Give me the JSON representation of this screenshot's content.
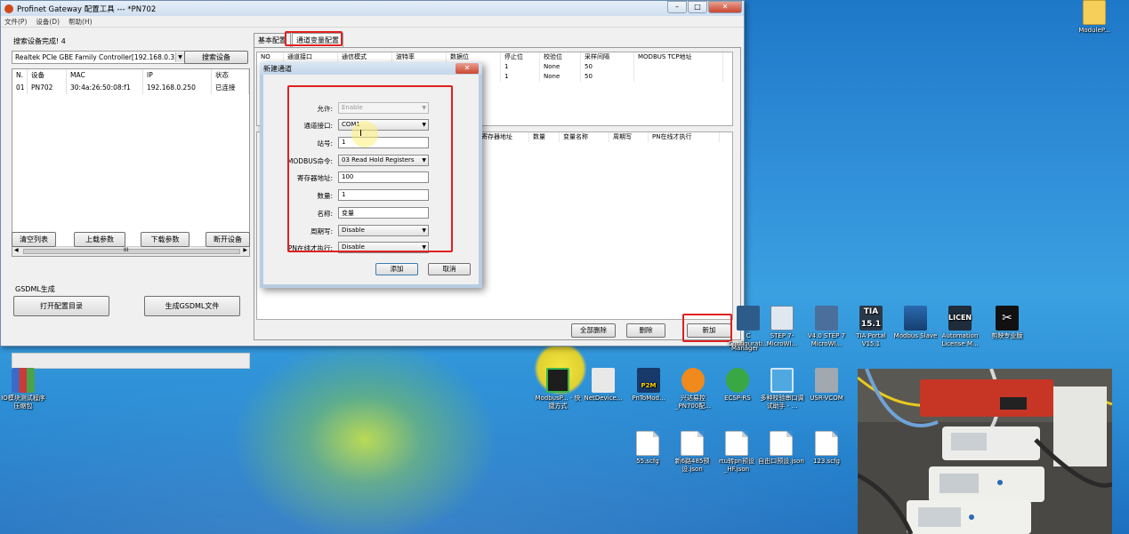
{
  "window": {
    "title": "Profinet Gateway 配置工具 --- *PN702",
    "menu": [
      "文件(P)",
      "设备(D)",
      "帮助(H)"
    ],
    "controls": {
      "minimize": "–",
      "maximize": "□",
      "close": "✕"
    }
  },
  "left": {
    "status": "搜索设备完成! 4",
    "adapter": "Realtek PCIe GBE Family Controller[192.168.0.33",
    "search_button": "搜索设备",
    "device_columns": [
      "N.",
      "设备",
      "MAC",
      "IP",
      "状态"
    ],
    "devices": [
      {
        "n": "01",
        "device": "PN702",
        "mac": "30:4a:26:50:08:f1",
        "ip": "192.168.0.250",
        "status": "已连接"
      }
    ],
    "scroll_grip": "III",
    "buttons": {
      "clear": "清空列表",
      "upload": "上载参数",
      "download": "下载参数",
      "disconnect": "断开设备"
    },
    "gsdml_label": "GSDML生成",
    "open_dir": "打开配置目录",
    "gen_gsdml": "生成GSDML文件"
  },
  "tabs": [
    "基本配置",
    "通道变量配置"
  ],
  "channel_grid": {
    "columns": [
      "NO",
      "通道接口",
      "通信模式",
      "波特率",
      "数据位",
      "停止位",
      "校验位",
      "采样间隔",
      "MODBUS TCP地址"
    ],
    "rows": [
      [
        "",
        "",
        "",
        "",
        "",
        "1",
        "None",
        "50",
        ""
      ],
      [
        "",
        "",
        "",
        "",
        "",
        "1",
        "None",
        "50",
        ""
      ]
    ]
  },
  "var_grid": {
    "columns": [
      "寄存器地址",
      "数量",
      "变量名称",
      "周期写",
      "PN在线才执行"
    ]
  },
  "bottom_buttons": {
    "delete_all": "全部删除",
    "delete": "删除",
    "add": "新加"
  },
  "dialog": {
    "title": "新建通道",
    "close": "✕",
    "fields": [
      {
        "label": "允许:",
        "value": "Enable",
        "type": "select",
        "disabled": true
      },
      {
        "label": "通道接口:",
        "value": "COM1",
        "type": "select"
      },
      {
        "label": "站号:",
        "value": "1",
        "type": "text"
      },
      {
        "label": "MODBUS命令:",
        "value": "03 Read Hold Registers",
        "type": "select"
      },
      {
        "label": "寄存器地址:",
        "value": "100",
        "type": "text"
      },
      {
        "label": "数量:",
        "value": "1",
        "type": "text"
      },
      {
        "label": "名称:",
        "value": "变量",
        "type": "text"
      },
      {
        "label": "周期写:",
        "value": "Disable",
        "type": "select"
      },
      {
        "label": "PN在线才执行:",
        "value": "Disable",
        "type": "select"
      }
    ],
    "ok": "添加",
    "cancel": "取消"
  },
  "desktop_icons": [
    {
      "label": "ModuleP...",
      "icon": "file-icon"
    },
    {
      "label": "STEP 7-MicroWI...",
      "icon": "step7-icon"
    },
    {
      "label": "V4.0 STEP 7 MicroWI...",
      "icon": "step7-v4-icon"
    },
    {
      "label": "TIA Portal V15.1",
      "icon": "tia-portal-icon",
      "badge": "TIA 15.1"
    },
    {
      "label": "Modbus Slave",
      "icon": "modbus-slave-icon"
    },
    {
      "label": "Automation License M...",
      "icon": "license-manager-icon",
      "badge": "LICEN"
    },
    {
      "label": "剪映专业版",
      "icon": "capcut-icon"
    },
    {
      "label": "C Configurati...",
      "icon": "config-icon"
    },
    {
      "label": "Manager",
      "icon": "manager-icon"
    },
    {
      "label": "IO模块测试程序压缩包",
      "icon": "winrar-icon"
    },
    {
      "label": "ModbusP... - 快捷方式",
      "icon": "modbus-poll-icon"
    },
    {
      "label": "NetDevice...",
      "icon": "netdevice-icon"
    },
    {
      "label": "PnToMod...",
      "icon": "p2m-icon",
      "badge": "P2M"
    },
    {
      "label": "兴达易控_PN700配...",
      "icon": "xingda-icon"
    },
    {
      "label": "ECSP-RS",
      "icon": "ecsp-icon"
    },
    {
      "label": "多种校验串口调试助手 - ...",
      "icon": "serial-tool-icon"
    },
    {
      "label": "USR-VCOM",
      "icon": "usr-vcom-icon"
    },
    {
      "label": "55.scfg",
      "icon": "file-icon"
    },
    {
      "label": "新6路485预设.json",
      "icon": "file-icon"
    },
    {
      "label": "rtu转pn预设_HF.json",
      "icon": "file-icon"
    },
    {
      "label": "自由口预设.json",
      "icon": "file-icon"
    },
    {
      "label": "123.scfg",
      "icon": "file-icon"
    }
  ],
  "colors": {
    "highlight": "#e02020",
    "window_border": "#6d8bab",
    "desktop": "#2f8ed8"
  }
}
